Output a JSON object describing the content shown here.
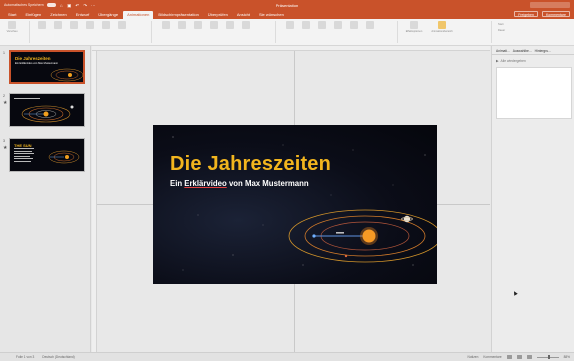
{
  "titlebar": {
    "autosave_label": "Automatisches Speichern",
    "title": "Präsentation"
  },
  "tabs": [
    "Start",
    "Einfügen",
    "Zeichnen",
    "Entwurf",
    "Übergänge",
    "Animationen",
    "Bildschirmpräsentation",
    "Überprüfen",
    "Ansicht",
    "Sie wünschen"
  ],
  "active_tab_index": 5,
  "tab_actions": {
    "share": "Freigeben",
    "comments": "Kommentare"
  },
  "ribbon": {
    "preview_label": "Vorschau",
    "effect_options_label": "Effektoptionen",
    "animation_pane_label": "Animationsbereich",
    "start_label": "Start",
    "duration_label": "Dauer"
  },
  "slides": [
    {
      "number": "1",
      "title": "Die Jahreszeiten",
      "subtitle": "Ein Erklärvideo von Max Mustermann"
    },
    {
      "number": "2",
      "title": "",
      "subtitle": ""
    },
    {
      "number": "3",
      "title": "THE SUN",
      "subtitle": ""
    }
  ],
  "slide_main": {
    "title": "Die Jahreszeiten",
    "subtitle_prefix": "Ein ",
    "subtitle_underlined": "Erklärvideo",
    "subtitle_suffix": " von Max Mustermann"
  },
  "right_pane": {
    "tabs": [
      "Animati...",
      "Auswahlbe...",
      "Hintergru..."
    ],
    "add_label": "Alle wiedergeben"
  },
  "statusbar": {
    "slide_counter": "Folie 1 von 3",
    "language": "Deutsch (Deutschland)",
    "notes": "Notizen",
    "comments": "Kommentare",
    "zoom": "88%"
  },
  "colors": {
    "accent": "#c9522a",
    "slide_title": "#f2b51e",
    "slide_bg": "#0b0d18"
  }
}
